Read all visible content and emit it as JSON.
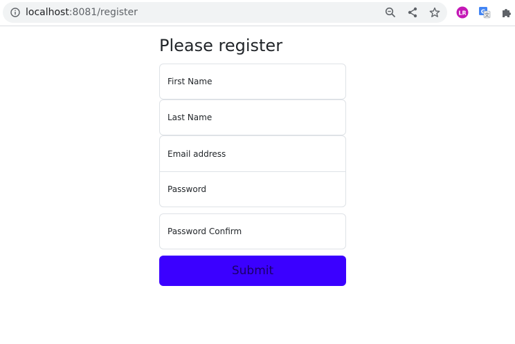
{
  "browser": {
    "url_host": "localhost",
    "url_rest": ":8081/register",
    "icons": [
      "info-icon",
      "zoom-icon",
      "share-icon",
      "bookmark-star-icon",
      "extension-lr-icon",
      "extension-translate-icon",
      "extensions-puzzle-icon"
    ]
  },
  "form": {
    "title": "Please register",
    "first_name_placeholder": "First Name",
    "last_name_placeholder": "Last Name",
    "email_placeholder": "Email address",
    "password_placeholder": "Password",
    "password_confirm_placeholder": "Password Confirm",
    "submit_label": "Submit"
  },
  "colors": {
    "submit_bg": "#3b00ff",
    "lr_extension": "#c418b6",
    "translate_extension": "#4285f4"
  }
}
